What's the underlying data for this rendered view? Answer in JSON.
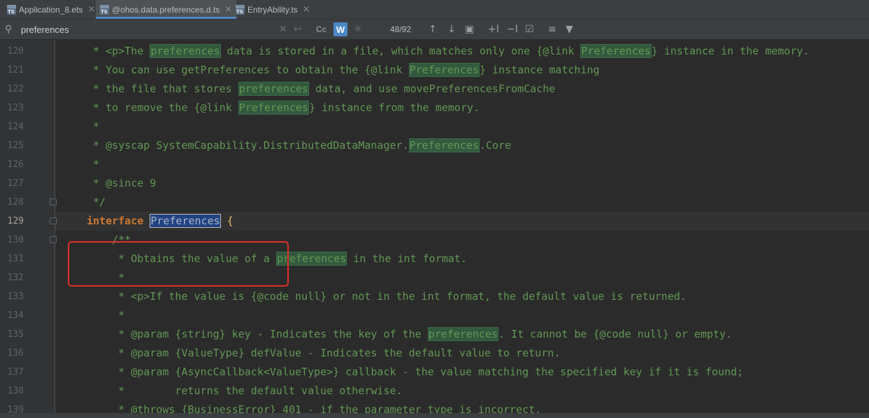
{
  "tabs": [
    {
      "label": "Application_8.ets",
      "icon": "ts-file-icon",
      "active": false
    },
    {
      "label": "@ohos.data.preferences.d.ts",
      "icon": "ts-file-icon",
      "active": true
    },
    {
      "label": "EntryAbility.ts",
      "icon": "ts-file-icon",
      "active": false
    }
  ],
  "find": {
    "query": "preferences",
    "match_case_label": "Cc",
    "words_label": "W",
    "match_count": "48/92"
  },
  "lines": [
    {
      "n": "120",
      "segs": [
        [
          "c",
          " * <p>The "
        ],
        [
          "h",
          "preferences"
        ],
        [
          "c",
          " data is stored in a file, which matches only one {@link "
        ],
        [
          "h",
          "Preferences"
        ],
        [
          "c",
          "} instance in the memory."
        ]
      ]
    },
    {
      "n": "121",
      "segs": [
        [
          "c",
          " * You can use getPreferences to obtain the {@link "
        ],
        [
          "h",
          "Preferences"
        ],
        [
          "c",
          "} instance matching"
        ]
      ]
    },
    {
      "n": "122",
      "segs": [
        [
          "c",
          " * the file that stores "
        ],
        [
          "h",
          "preferences"
        ],
        [
          "c",
          " data, and use movePreferencesFromCache"
        ]
      ]
    },
    {
      "n": "123",
      "segs": [
        [
          "c",
          " * to remove the {@link "
        ],
        [
          "h",
          "Preferences"
        ],
        [
          "c",
          "} instance from the memory."
        ]
      ]
    },
    {
      "n": "124",
      "segs": [
        [
          "c",
          " *"
        ]
      ]
    },
    {
      "n": "125",
      "segs": [
        [
          "c",
          " * @syscap SystemCapability.DistributedDataManager."
        ],
        [
          "h",
          "Preferences"
        ],
        [
          "c",
          ".Core"
        ]
      ]
    },
    {
      "n": "126",
      "segs": [
        [
          "c",
          " *"
        ]
      ]
    },
    {
      "n": "127",
      "segs": [
        [
          "c",
          " * @since 9"
        ]
      ]
    },
    {
      "n": "128",
      "segs": [
        [
          "c",
          " */"
        ]
      ]
    },
    {
      "n": "129",
      "segs": [
        [
          "k",
          "interface"
        ],
        [
          "t",
          " "
        ],
        [
          "s",
          "Preferences"
        ],
        [
          "t",
          " "
        ],
        [
          "b",
          "{"
        ]
      ]
    },
    {
      "n": "130",
      "segs": [
        [
          "c",
          "    /**"
        ]
      ]
    },
    {
      "n": "131",
      "segs": [
        [
          "c",
          "     * Obtains the value of a "
        ],
        [
          "h",
          "preferences"
        ],
        [
          "c",
          " in the int format."
        ]
      ]
    },
    {
      "n": "132",
      "segs": [
        [
          "c",
          "     *"
        ]
      ]
    },
    {
      "n": "133",
      "segs": [
        [
          "c",
          "     * <p>If the value is {@code null} or not in the int format, the default value is returned."
        ]
      ]
    },
    {
      "n": "134",
      "segs": [
        [
          "c",
          "     *"
        ]
      ]
    },
    {
      "n": "135",
      "segs": [
        [
          "c",
          "     * @param {string} key - Indicates the key of the "
        ],
        [
          "h",
          "preferences"
        ],
        [
          "c",
          ". It cannot be {@code null} or empty."
        ]
      ]
    },
    {
      "n": "136",
      "segs": [
        [
          "c",
          "     * @param {ValueType} defValue - Indicates the default value to return."
        ]
      ]
    },
    {
      "n": "137",
      "segs": [
        [
          "c",
          "     * @param {AsyncCallback<ValueType>} callback - the value matching the specified key if it is found;"
        ]
      ]
    },
    {
      "n": "138",
      "segs": [
        [
          "c",
          "     *        returns the default value otherwise."
        ]
      ]
    },
    {
      "n": "139",
      "segs": [
        [
          "c",
          "     * @throws {BusinessError} 401 - if the parameter type is incorrect."
        ]
      ]
    }
  ],
  "colors": {
    "accent": "#4a88c7",
    "highlight": "#32593d",
    "selection": "#214283",
    "annotation_box": "#e0302a"
  }
}
